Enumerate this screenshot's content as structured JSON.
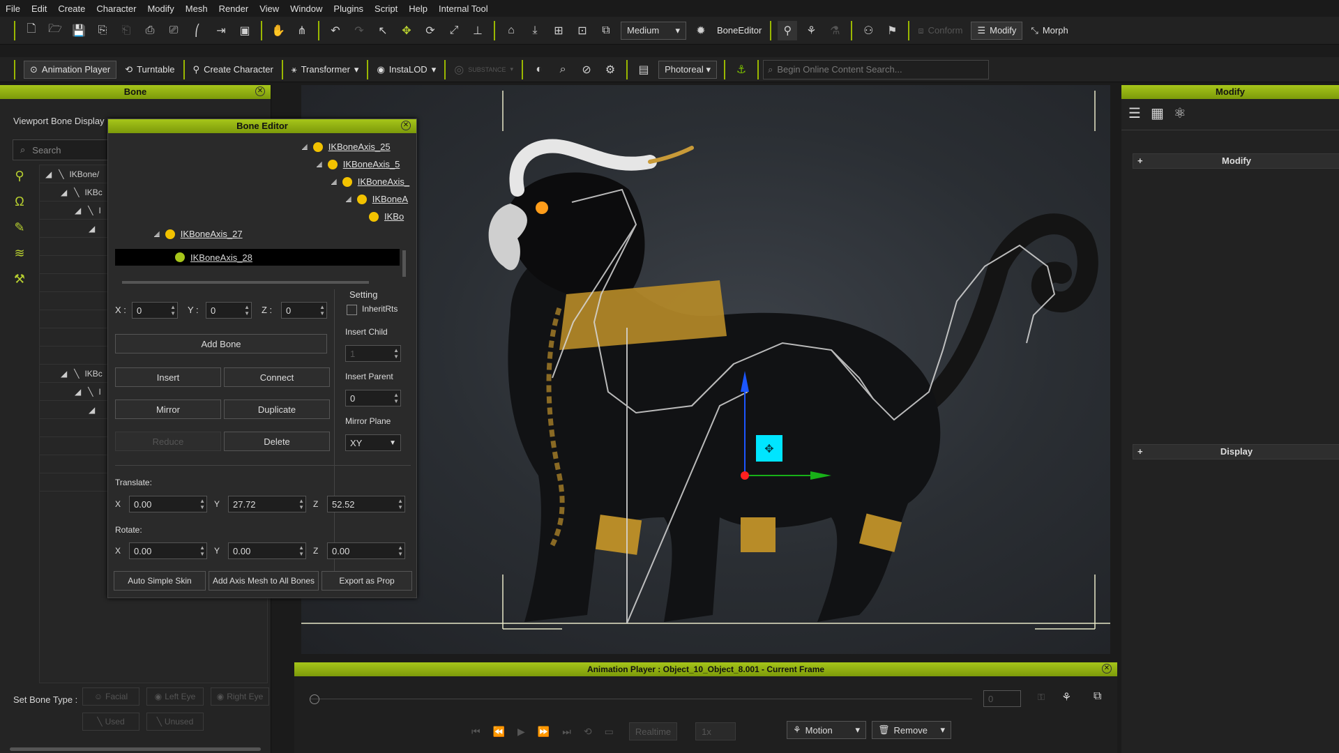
{
  "menu": [
    "File",
    "Edit",
    "Create",
    "Character",
    "Modify",
    "Mesh",
    "Render",
    "View",
    "Window",
    "Plugins",
    "Script",
    "Help",
    "Internal Tool"
  ],
  "toolbar1": {
    "quality": "Medium",
    "bone_editor_label": "BoneEditor",
    "conform_label": "Conform",
    "modify_label": "Modify",
    "morph_label": "Morph"
  },
  "toolbar2": {
    "animation_player": "Animation Player",
    "turntable": "Turntable",
    "create_character": "Create Character",
    "transformer": "Transformer",
    "instalod": "InstaLOD",
    "substance": "SUBSTANCE",
    "render_mode": "Photoreal",
    "search_placeholder": "Begin Online Content Search..."
  },
  "bone_panel": {
    "title": "Bone",
    "viewport_bone_display": "Viewport Bone Display",
    "search_placeholder": "Search",
    "tree": [
      "IKBone/",
      "IKBc",
      "I",
      "",
      ""
    ],
    "tree2": [
      "IKBc",
      "I",
      ""
    ],
    "set_bone_type": "Set Bone Type :",
    "types": [
      "Facial",
      "Left Eye",
      "Right Eye",
      "Used",
      "Unused"
    ]
  },
  "bone_editor": {
    "title": "Bone Editor",
    "tree": [
      "IKBoneAxis_25",
      "IKBoneAxis_5",
      "IKBoneAxis_",
      "IKBoneA",
      "IKBo",
      "IKBoneAxis_27",
      "IKBoneAxis_28"
    ],
    "x_label": "X :",
    "y_label": "Y :",
    "z_label": "Z :",
    "x": "0",
    "y": "0",
    "z": "0",
    "setting": "Setting",
    "inherit_rts": "InheritRts",
    "insert_child": "Insert Child",
    "insert_child_value": "1",
    "insert_parent": "Insert Parent",
    "insert_parent_value": "0",
    "mirror_plane": "Mirror Plane",
    "mirror_plane_value": "XY",
    "add_bone": "Add Bone",
    "insert": "Insert",
    "connect": "Connect",
    "mirror": "Mirror",
    "duplicate": "Duplicate",
    "reduce": "Reduce",
    "delete": "Delete",
    "translate": "Translate:",
    "tx": "0.00",
    "ty": "27.72",
    "tz": "52.52",
    "rotate": "Rotate:",
    "rx": "0.00",
    "ry": "0.00",
    "rz": "0.00",
    "ax": "X",
    "ay": "Y",
    "az": "Z",
    "auto_simple_skin": "Auto Simple Skin",
    "add_axis_mesh": "Add Axis Mesh to All Bones",
    "export_as_prop": "Export as Prop"
  },
  "modify_panel": {
    "title": "Modify",
    "section_modify": "Modify",
    "section_display": "Display"
  },
  "animation_player": {
    "title": "Animation Player : Object_10_Object_8.001 - Current Frame",
    "frame": "0",
    "realtime": "Realtime",
    "speed": "1x",
    "motion": "Motion",
    "remove": "Remove"
  },
  "colors": {
    "accent": "#9ab800",
    "header_green": "#8fb012",
    "bone_dot": "#f2c200",
    "gizmo_cyan": "#00e5ff"
  }
}
